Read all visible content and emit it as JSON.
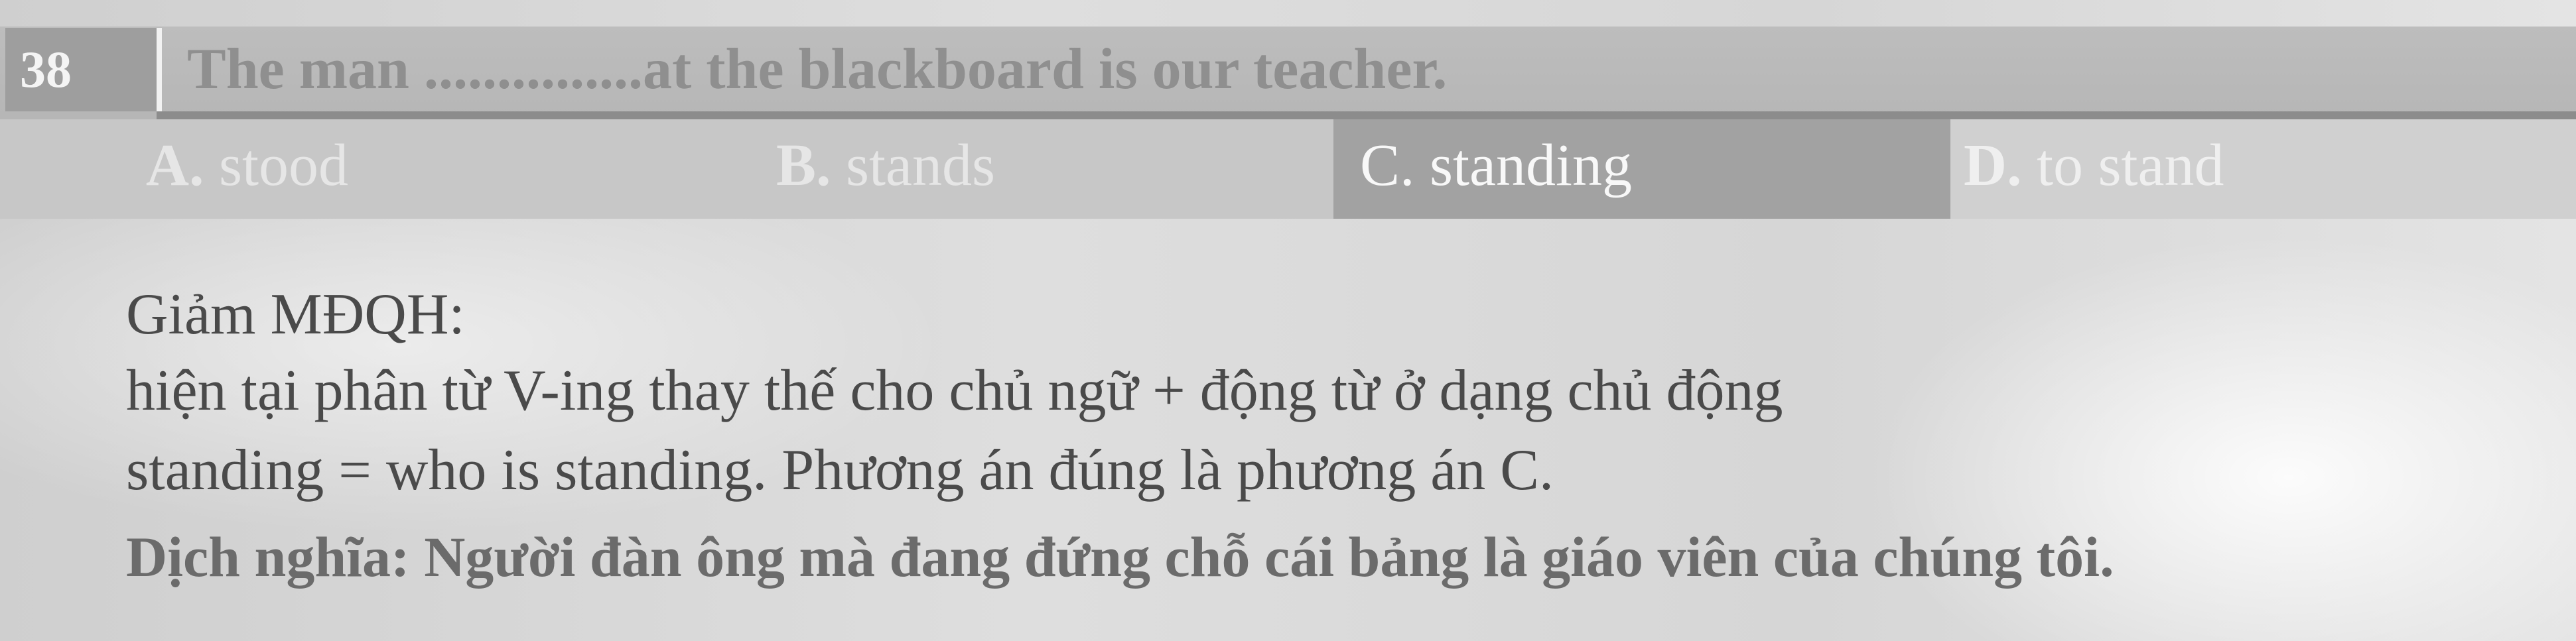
{
  "question": {
    "number": "38",
    "text": "The man ...............at the blackboard is our teacher."
  },
  "options": [
    {
      "letter": "A.",
      "text": "stood"
    },
    {
      "letter": "B.",
      "text": "stands"
    },
    {
      "letter": "C.",
      "text": "standing"
    },
    {
      "letter": "D.",
      "text": "to stand"
    }
  ],
  "explanation": {
    "heading": "Giảm MĐQH:",
    "line1": "hiện tại phân từ V-ing thay thế cho chủ ngữ + động từ ở dạng chủ động",
    "line2": "standing = who is standing. Phương án đúng là phương án C."
  },
  "translation": "Dịch nghĩa: Người đàn ông mà đang đứng chỗ cái bảng là giáo viên của chúng tôi.",
  "colors": {
    "header_band": "#bdbdbd",
    "number_box": "#9e9e9e",
    "selected_option": "#a2a2a2",
    "body_text": "#4a4a4a"
  }
}
